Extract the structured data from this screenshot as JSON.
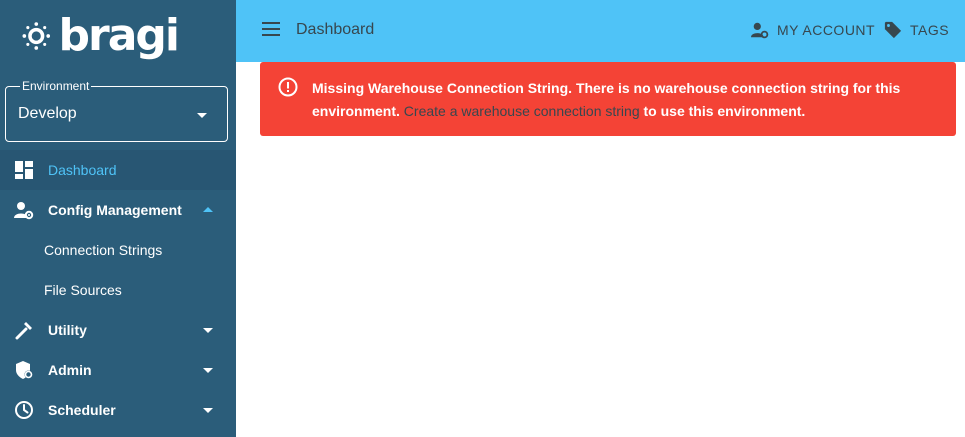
{
  "brand": {
    "name": "bragi"
  },
  "environment": {
    "label": "Environment",
    "value": "Develop"
  },
  "nav": {
    "dashboard": "Dashboard",
    "config": "Config Management",
    "config_sub": [
      "Connection Strings",
      "File Sources"
    ],
    "utility": "Utility",
    "admin": "Admin",
    "scheduler": "Scheduler"
  },
  "topbar": {
    "title": "Dashboard",
    "account": "MY ACCOUNT",
    "tags": "TAGS"
  },
  "alert": {
    "bold_text": "Missing Warehouse Connection String. There is no warehouse connection string for this environment.",
    "link_text": "Create a warehouse connection string",
    "tail_text": "to use this environment."
  },
  "colors": {
    "sidebar": "#2b5d7a",
    "topbar": "#4fc3f7",
    "alert": "#f44336",
    "active_text": "#4fc3f7"
  }
}
